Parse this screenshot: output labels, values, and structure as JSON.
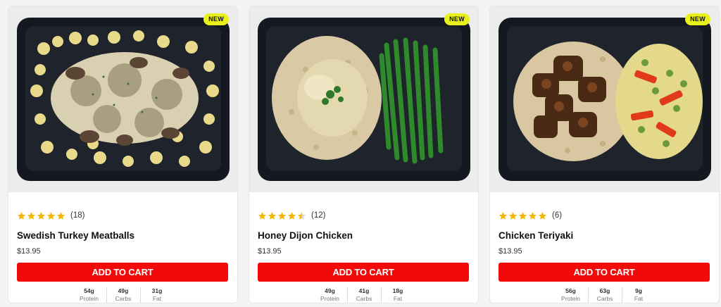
{
  "products": [
    {
      "badge": "NEW",
      "image": "swedish-turkey-meatballs-photo",
      "rating": 5,
      "review_count": "(18)",
      "name": "Swedish Turkey Meatballs",
      "price": "$13.95",
      "cta": "ADD TO CART",
      "macros": [
        {
          "value": "54g",
          "label": "Protein"
        },
        {
          "value": "49g",
          "label": "Carbs"
        },
        {
          "value": "31g",
          "label": "Fat"
        }
      ]
    },
    {
      "badge": "NEW",
      "image": "honey-dijon-chicken-photo",
      "rating": 4.5,
      "review_count": "(12)",
      "name": "Honey Dijon Chicken",
      "price": "$13.95",
      "cta": "ADD TO CART",
      "macros": [
        {
          "value": "49g",
          "label": "Protein"
        },
        {
          "value": "41g",
          "label": "Carbs"
        },
        {
          "value": "18g",
          "label": "Fat"
        }
      ]
    },
    {
      "badge": "NEW",
      "image": "chicken-teriyaki-photo",
      "rating": 5,
      "review_count": "(6)",
      "name": "Chicken Teriyaki",
      "price": "$13.95",
      "cta": "ADD TO CART",
      "macros": [
        {
          "value": "56g",
          "label": "Protein"
        },
        {
          "value": "63g",
          "label": "Carbs"
        },
        {
          "value": "9g",
          "label": "Fat"
        }
      ]
    }
  ],
  "colors": {
    "star": "#f2b705",
    "cta": "#f20a0a",
    "badge": "#e8f21a",
    "tray": "#141820"
  }
}
